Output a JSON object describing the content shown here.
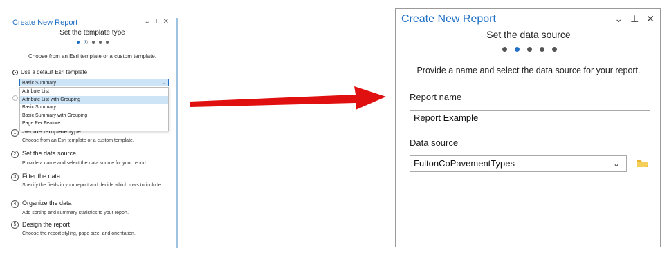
{
  "left_panel": {
    "title": "Create New Report",
    "controls": "⌄ ⊥ ✕",
    "step_title": "Set the template type",
    "description": "Choose from an Esri template or a custom template.",
    "radio_default_label": "Use a default Esri template",
    "select_value": "Basic Summary",
    "dropdown_options": [
      "Attribute List",
      "Attribute List with Grouping",
      "Basic Summary",
      "Basic Summary with Grouping",
      "Page Per Feature"
    ],
    "steps": [
      {
        "num": "1",
        "title": "Set the template type",
        "desc": "Choose from an Esri template or a custom template."
      },
      {
        "num": "2",
        "title": "Set the data source",
        "desc": "Provide a name and select the data source for your report."
      },
      {
        "num": "3",
        "title": "Filter the data",
        "desc": "Specify the fields in your report and decide which rows to include."
      },
      {
        "num": "4",
        "title": "Organize the data",
        "desc": "Add sorting and summary statistics to your report."
      },
      {
        "num": "5",
        "title": "Design the report",
        "desc": "Choose the report styling, page size, and orientation."
      }
    ]
  },
  "right_panel": {
    "title": "Create New Report",
    "step_title": "Set the data source",
    "description": "Provide a name and select the data source for your report.",
    "report_name_label": "Report name",
    "report_name_value": "Report Example",
    "data_source_label": "Data source",
    "data_source_value": "FultonCoPavementTypes"
  },
  "colors": {
    "accent": "#1f6fc5",
    "arrow": "#e01010",
    "highlight": "#cde4f7",
    "folder": "#f0c040"
  },
  "icons": [
    "chevron-down-icon",
    "pin-icon",
    "close-icon",
    "folder-icon",
    "arrow-right-icon"
  ]
}
